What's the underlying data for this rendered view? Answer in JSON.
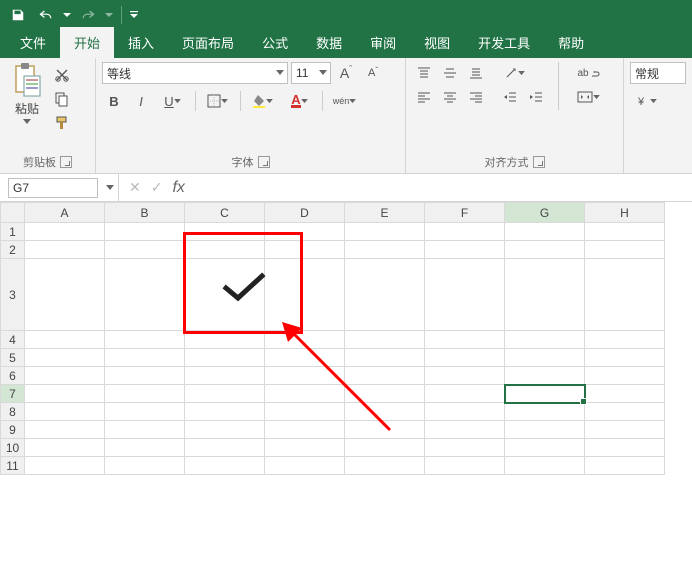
{
  "titlebar": {
    "save_title": "保存",
    "undo_title": "撤消",
    "redo_title": "恢复"
  },
  "tabs": {
    "file": "文件",
    "home": "开始",
    "insert": "插入",
    "page_layout": "页面布局",
    "formulas": "公式",
    "data": "数据",
    "review": "审阅",
    "view": "视图",
    "developer": "开发工具",
    "help": "帮助"
  },
  "ribbon": {
    "clipboard": {
      "paste": "粘贴",
      "label": "剪贴板"
    },
    "font": {
      "name": "等线",
      "size": "11",
      "bold": "B",
      "italic": "I",
      "underline": "U",
      "ruby": "wén",
      "label": "字体"
    },
    "alignment": {
      "wrap": "ab",
      "label": "对齐方式"
    },
    "number": {
      "format": "常规",
      "label": ""
    }
  },
  "formula_bar": {
    "namebox": "G7",
    "fx": "fx"
  },
  "grid": {
    "columns": [
      "A",
      "B",
      "C",
      "D",
      "E",
      "F",
      "G",
      "H"
    ],
    "rows": [
      "1",
      "2",
      "3",
      "4",
      "5",
      "6",
      "7",
      "8",
      "9",
      "10",
      "11"
    ],
    "active_cell": "G7",
    "checkmark_cell": "C3"
  },
  "chart_data": null
}
